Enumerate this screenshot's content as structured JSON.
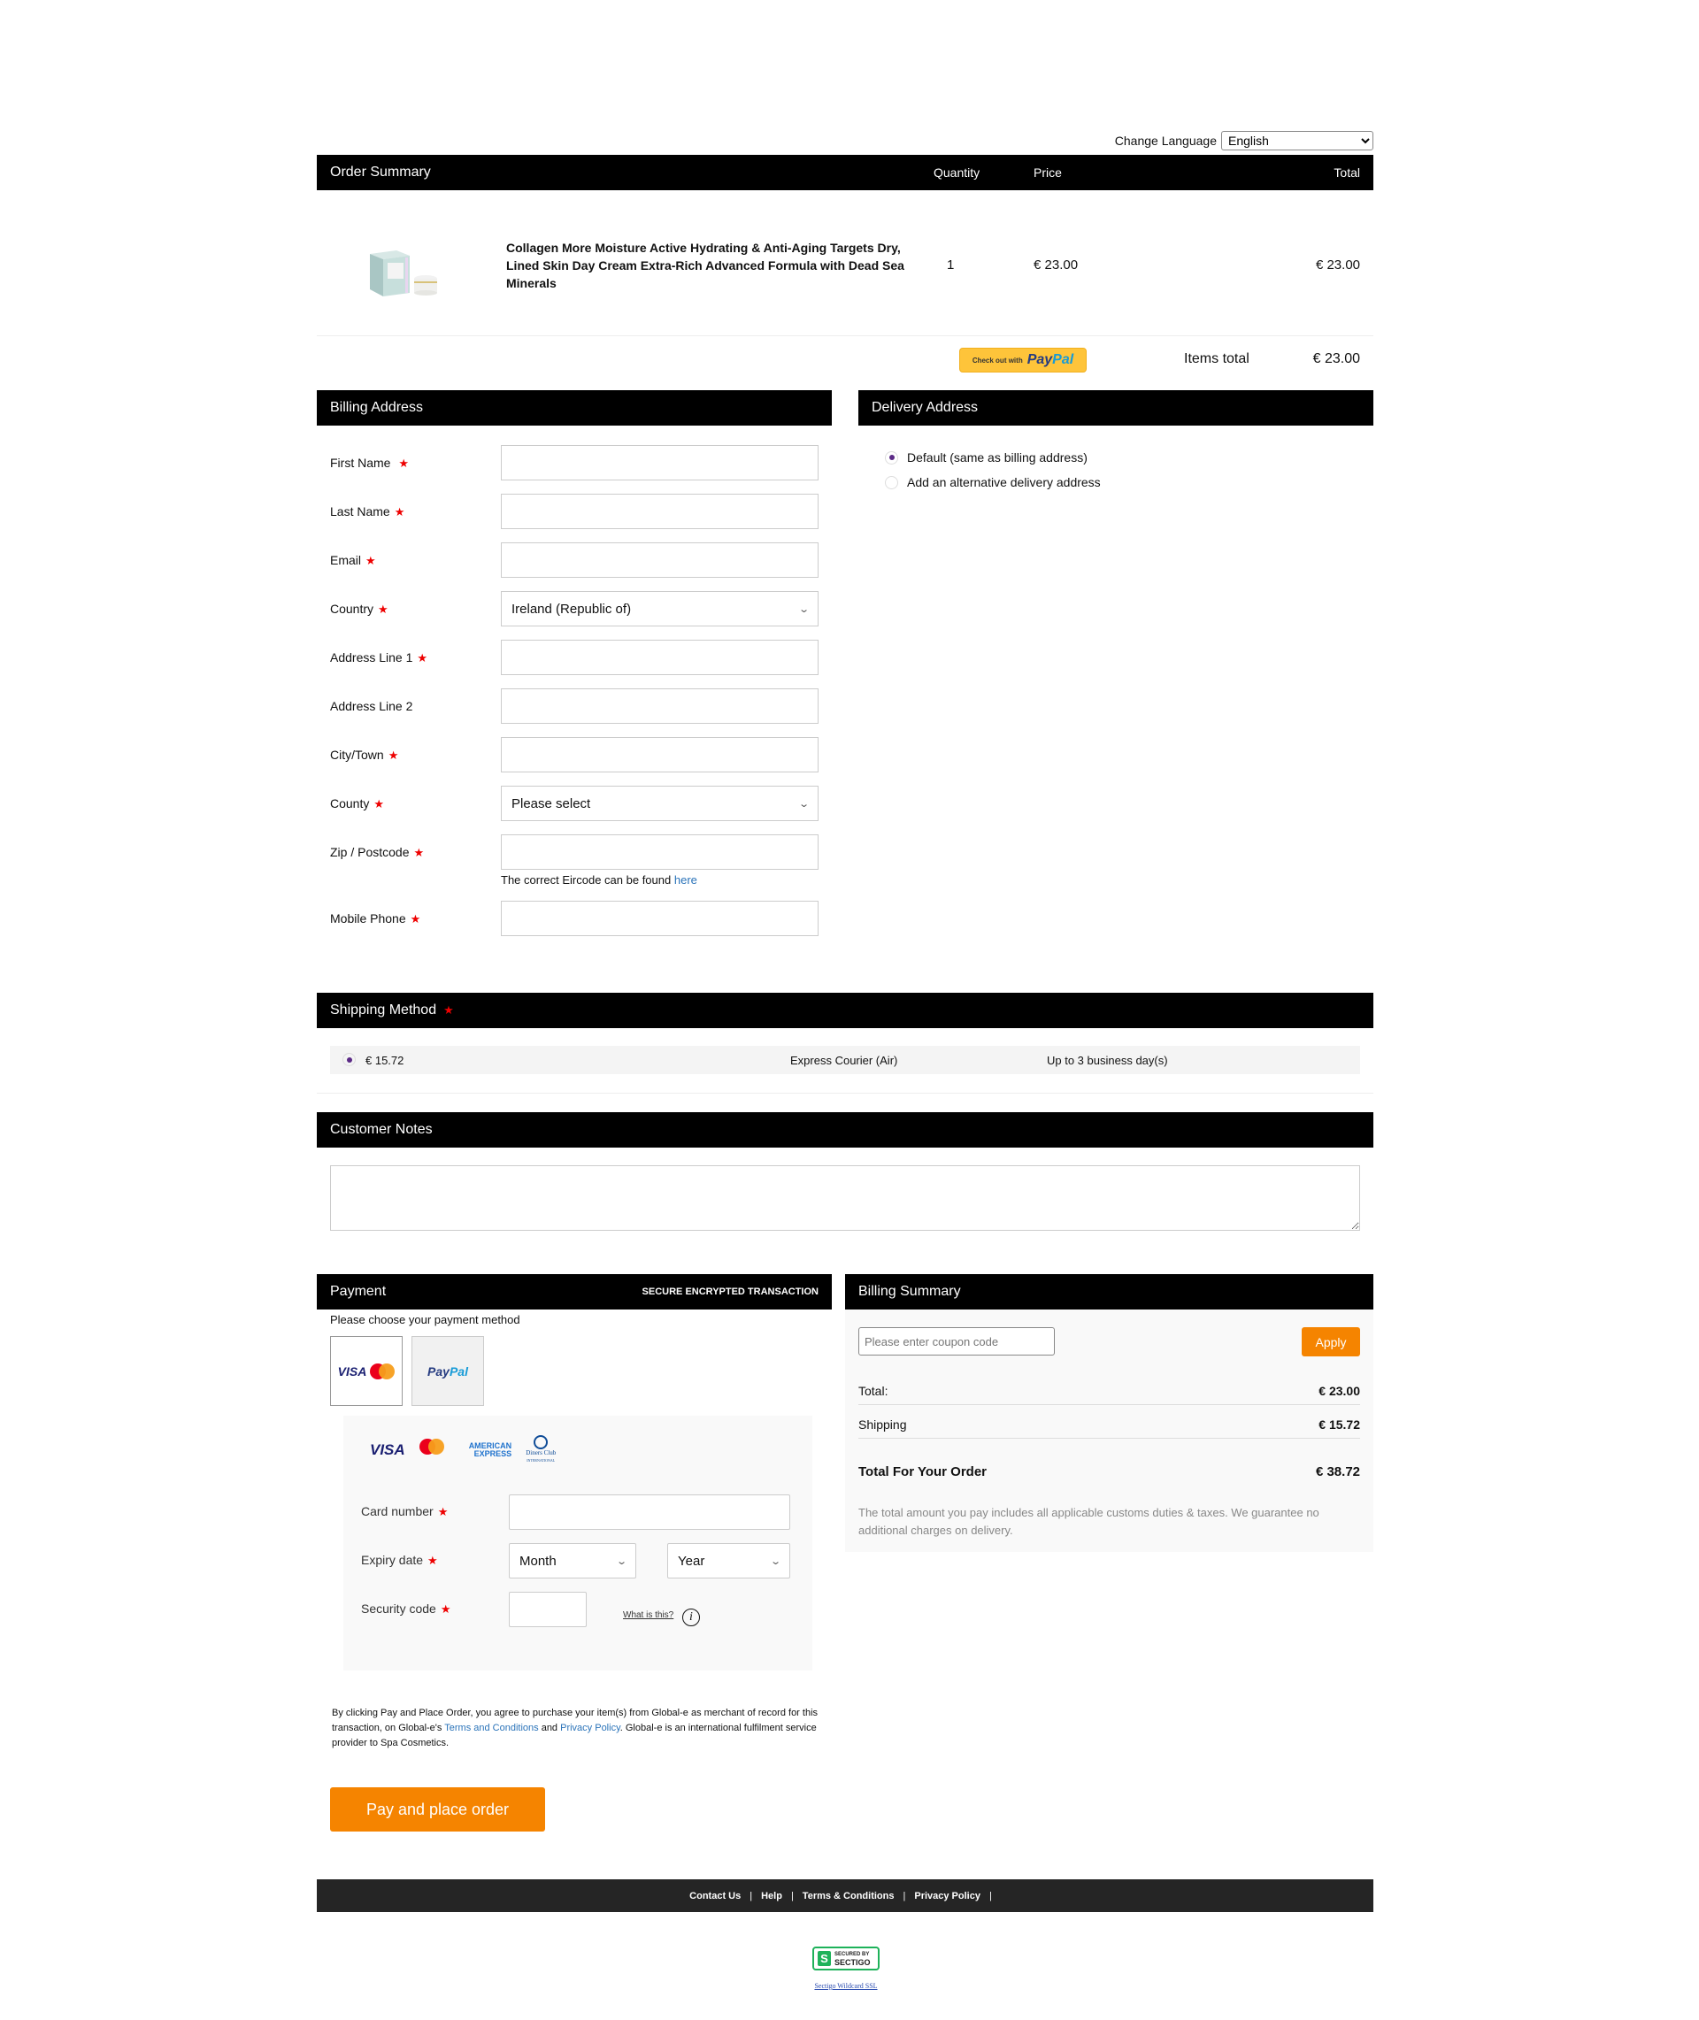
{
  "language": {
    "label": "Change Language",
    "selected": "English"
  },
  "order_summary": {
    "title": "Order Summary",
    "columns": {
      "quantity": "Quantity",
      "price": "Price",
      "total": "Total"
    },
    "items": [
      {
        "title": "Collagen More Moisture Active Hydrating & Anti-Aging Targets Dry, Lined Skin Day Cream Extra-Rich Advanced Formula with Dead Sea Minerals",
        "image_alt": "collagen cream product image",
        "quantity": "1",
        "price": "€ 23.00",
        "total": "€ 23.00"
      }
    ],
    "paypal_button": {
      "prefix": "Check out with",
      "brand_a": "Pay",
      "brand_b": "Pal"
    },
    "items_total_label": "Items total",
    "items_total_value": "€ 23.00"
  },
  "billing_address": {
    "title": "Billing Address",
    "fields": [
      {
        "label": "First Name",
        "required": true,
        "value": "",
        "type": "text"
      },
      {
        "label": "Last Name",
        "required": true,
        "value": "",
        "type": "text"
      },
      {
        "label": "Email",
        "required": true,
        "value": "",
        "type": "text"
      },
      {
        "label": "Country",
        "required": true,
        "value": "Ireland (Republic of)",
        "type": "select"
      },
      {
        "label": "Address Line 1",
        "required": true,
        "value": "",
        "type": "text"
      },
      {
        "label": "Address Line 2",
        "required": false,
        "value": "",
        "type": "text"
      },
      {
        "label": "City/Town",
        "required": true,
        "value": "",
        "type": "text"
      },
      {
        "label": "County",
        "required": true,
        "value": "Please select",
        "type": "select"
      },
      {
        "label": "Zip / Postcode",
        "required": true,
        "value": "",
        "type": "text"
      },
      {
        "label": "Mobile Phone",
        "required": true,
        "value": "",
        "type": "text"
      }
    ],
    "eircode_hint": "The correct Eircode can be found",
    "eircode_link": "here",
    "required_mark": "★"
  },
  "delivery_address": {
    "title": "Delivery Address",
    "options": [
      {
        "label": "Default (same as billing address)",
        "selected": true
      },
      {
        "label": "Add an alternative delivery address",
        "selected": false
      }
    ]
  },
  "shipping_method": {
    "title": "Shipping Method",
    "options": [
      {
        "price": "€ 15.72",
        "name": "Express Courier (Air)",
        "eta": "Up to 3 business day(s)",
        "selected": true
      }
    ]
  },
  "customer_notes": {
    "title": "Customer Notes",
    "value": ""
  },
  "payment": {
    "title": "Payment",
    "secure_label": "SECURE ENCRYPTED TRANSACTION",
    "choose_label": "Please choose your payment method",
    "methods": [
      {
        "label": "VISA",
        "name": "card",
        "selected": true
      },
      {
        "label_a": "Pay",
        "label_b": "Pal",
        "name": "paypal",
        "selected": false
      }
    ],
    "card_logos": {
      "visa": "VISA",
      "amex_1": "AMERICAN",
      "amex_2": "EXPRESS",
      "diners_1": "Diners Club",
      "diners_2": "INTERNATIONAL"
    },
    "card_number_label": "Card number",
    "card_number_value": "",
    "expiry_label": "Expiry date",
    "month_value": "Month",
    "year_value": "Year",
    "security_label": "Security code",
    "security_value": "",
    "what_is_this": "What is this?",
    "info_glyph": "i",
    "terms": {
      "part1": "By clicking Pay and Place Order, you agree to purchase your item(s) from Global-e as merchant of record for this transaction, on Global-e's ",
      "link1": "Terms and Conditions",
      "part2": " and ",
      "link2": "Privacy Policy",
      "part3": ". Global-e is an international fulfilment service provider to Spa Cosmetics."
    },
    "pay_button": "Pay and place order"
  },
  "billing_summary": {
    "title": "Billing Summary",
    "coupon_placeholder": "Please enter coupon code",
    "apply_label": "Apply",
    "total_label": "Total:",
    "total_value": "€ 23.00",
    "shipping_label": "Shipping",
    "shipping_value": "€ 15.72",
    "order_total_label": "Total For Your Order",
    "order_total_value": "€ 38.72",
    "note": "The total amount you pay includes all applicable customs duties & taxes. We guarantee no additional charges on delivery."
  },
  "footer": {
    "links": [
      "Contact Us",
      "Help",
      "Terms & Conditions",
      "Privacy Policy"
    ],
    "separator": "|"
  },
  "sectigo": {
    "badge_s": "S",
    "line1": "SECURED BY",
    "line2": "SECTIGO",
    "link": "Sectigo Wildcard SSL"
  },
  "colors": {
    "accent": "#f58400",
    "header_bg": "#000000",
    "footer_bg": "#252525",
    "required": "#ee0000",
    "radio": "#5b2a86",
    "link": "#2a73b9"
  }
}
